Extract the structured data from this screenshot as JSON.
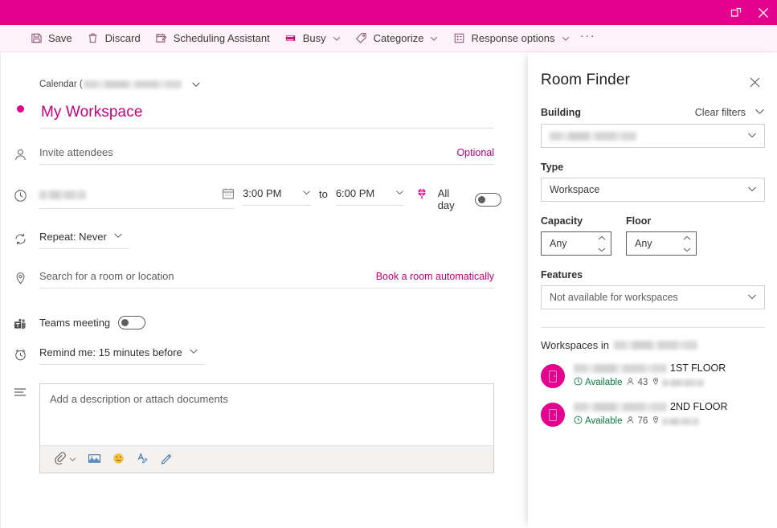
{
  "window": {
    "popout_title": "Pop out",
    "close_title": "Close",
    "accent_color": "#e3008c",
    "link_color": "#c2007a",
    "available_color": "#0b7a3e"
  },
  "toolbar": {
    "items": [
      {
        "label": "Save",
        "icon": "save-icon",
        "caret": false
      },
      {
        "label": "Discard",
        "icon": "trash-icon",
        "caret": false
      },
      {
        "label": "Scheduling Assistant",
        "icon": "scheduling-assistant-icon",
        "caret": false
      },
      {
        "label": "Busy",
        "icon": "busy-status-icon",
        "caret": true
      },
      {
        "label": "Categorize",
        "icon": "tag-icon",
        "caret": true
      },
      {
        "label": "Response options",
        "icon": "response-options-icon",
        "caret": true
      }
    ],
    "overflow_label": "···"
  },
  "form": {
    "calendar": {
      "label": "Calendar (",
      "value_redacted": true,
      "icon": "chevron-down-icon"
    },
    "title": {
      "value": "My Workspace",
      "bullet_icon": "category-dot-icon"
    },
    "attendees": {
      "icon": "person-icon",
      "placeholder": "Invite attendees",
      "optional_label": "Optional"
    },
    "datetime": {
      "icon": "clock-icon",
      "date_value_redacted": true,
      "calendar_icon": "calendar-icon",
      "start_time": "3:00 PM",
      "to_label": "to",
      "end_time": "6:00 PM",
      "timezone_icon": "timezone-icon",
      "all_day_label": "All day",
      "all_day_on": false
    },
    "repeat": {
      "icon": "repeat-icon",
      "label": "Repeat: Never"
    },
    "location": {
      "icon": "location-pin-icon",
      "placeholder": "Search for a room or location",
      "book_link": "Book a room automatically"
    },
    "teams": {
      "icon": "teams-icon",
      "label": "Teams meeting",
      "on": false
    },
    "reminder": {
      "icon": "alarm-clock-icon",
      "label": "Remind me: 15 minutes before"
    },
    "description": {
      "icon": "description-lines-icon",
      "placeholder": "Add a description or attach documents",
      "tools": [
        {
          "name": "attach-file-icon",
          "label": "Attach"
        },
        {
          "name": "insert-picture-icon",
          "label": "Insert picture"
        },
        {
          "name": "emoji-icon",
          "label": "Emoji"
        },
        {
          "name": "insert-signature-icon",
          "label": "Signature"
        },
        {
          "name": "edit-pen-icon",
          "label": "Edit"
        }
      ]
    }
  },
  "room_finder": {
    "title": "Room Finder",
    "close_icon": "close-icon",
    "building": {
      "label": "Building",
      "clear_filters": "Clear filters",
      "value_redacted": true
    },
    "type": {
      "label": "Type",
      "value": "Workspace"
    },
    "capacity": {
      "label": "Capacity",
      "value": "Any"
    },
    "floor": {
      "label": "Floor",
      "value": "Any"
    },
    "features": {
      "label": "Features",
      "value": "Not available for workspaces"
    },
    "results": {
      "heading_prefix": "Workspaces in",
      "heading_value_redacted": true,
      "items": [
        {
          "name_redacted": true,
          "name_suffix": "1ST FLOOR",
          "status": "Available",
          "capacity": "43",
          "location_redacted": true
        },
        {
          "name_redacted": true,
          "name_suffix": "2ND FLOOR",
          "status": "Available",
          "capacity": "76",
          "location_redacted": true
        }
      ]
    }
  }
}
